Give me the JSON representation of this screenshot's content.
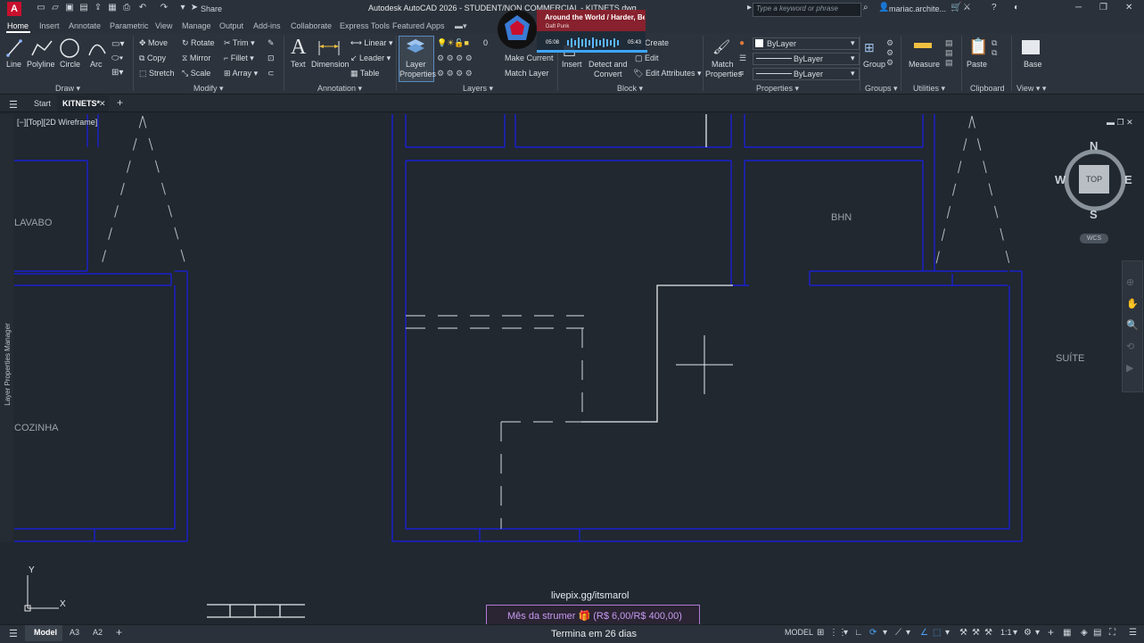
{
  "window": {
    "title": "Autodesk AutoCAD 2026 - STUDENT/NON COMMERCIAL - KITNETS.dwg",
    "app_letter": "A",
    "share_label": "Share",
    "search_placeholder": "Type a keyword or phrase",
    "user_name": "mariac.archite..."
  },
  "ribbon_tabs": [
    "Home",
    "Insert",
    "Annotate",
    "Parametric",
    "View",
    "Manage",
    "Output",
    "Add-ins",
    "Collaborate",
    "Express Tools",
    "Featured Apps"
  ],
  "ribbon": {
    "draw": {
      "line": "Line",
      "polyline": "Polyline",
      "circle": "Circle",
      "arc": "Arc",
      "title": "Draw"
    },
    "modify": {
      "move": "Move",
      "rotate": "Rotate",
      "trim": "Trim",
      "copy": "Copy",
      "mirror": "Mirror",
      "fillet": "Fillet",
      "stretch": "Stretch",
      "scale": "Scale",
      "array": "Array",
      "title": "Modify"
    },
    "annotation": {
      "text": "Text",
      "dimension": "Dimension",
      "linear": "Linear",
      "leader": "Leader",
      "table": "Table",
      "title": "Annotation"
    },
    "layers": {
      "layer_properties_1": "Layer",
      "layer_properties_2": "Properties",
      "current_layer": "0",
      "make_current": "Make Current",
      "match_layer": "Match Layer",
      "title": "Layers"
    },
    "block": {
      "insert": "Insert",
      "create": "Create",
      "edit": "Edit",
      "detect_1": "Detect and",
      "detect_2": "Convert",
      "edit_attributes": "Edit Attributes",
      "title": "Block"
    },
    "properties": {
      "match_1": "Match",
      "match_2": "Properties",
      "color": "ByLayer",
      "linetype": "ByLayer",
      "lineweight": "ByLayer",
      "title": "Properties"
    },
    "groups": {
      "group": "Group",
      "title": "Groups"
    },
    "utilities": {
      "measure": "Measure",
      "title": "Utilities"
    },
    "clipboard": {
      "paste": "Paste",
      "title": "Clipboard"
    },
    "view": {
      "base": "Base",
      "title": "View"
    }
  },
  "file_tabs": {
    "start": "Start",
    "active": "KITNETS*"
  },
  "viewport": {
    "label": "[−][Top][2D Wireframe]",
    "side_palette": "Layer Properties Manager"
  },
  "rooms": {
    "lavabo": "LAVABO",
    "cozinha": "COZINHA",
    "bhn": "BHN",
    "suite": "SUÍTE"
  },
  "viewcube": {
    "north": "N",
    "south": "S",
    "east": "E",
    "west": "W",
    "face": "TOP",
    "wcs": "WCS"
  },
  "ucs": {
    "x": "X",
    "y": "Y"
  },
  "media_player": {
    "track": "Around the World / Harder, Be",
    "artist": "Daft Punk",
    "elapsed": "05:08",
    "total": "05:43"
  },
  "stream": {
    "url": "livepix.gg/itsmarol",
    "goal": "Mês da strumer 🎁 (R$ 6,00/R$ 400,00)",
    "ends": "Termina em 26 dias"
  },
  "status_bar": {
    "model_tab": "Model",
    "layout1": "A3",
    "layout2": "A2",
    "space": "MODEL",
    "scale": "1:1"
  },
  "colors": {
    "wall_blue": "#1a1fd0",
    "accent_purple": "#b07ad8",
    "background": "#212830"
  }
}
